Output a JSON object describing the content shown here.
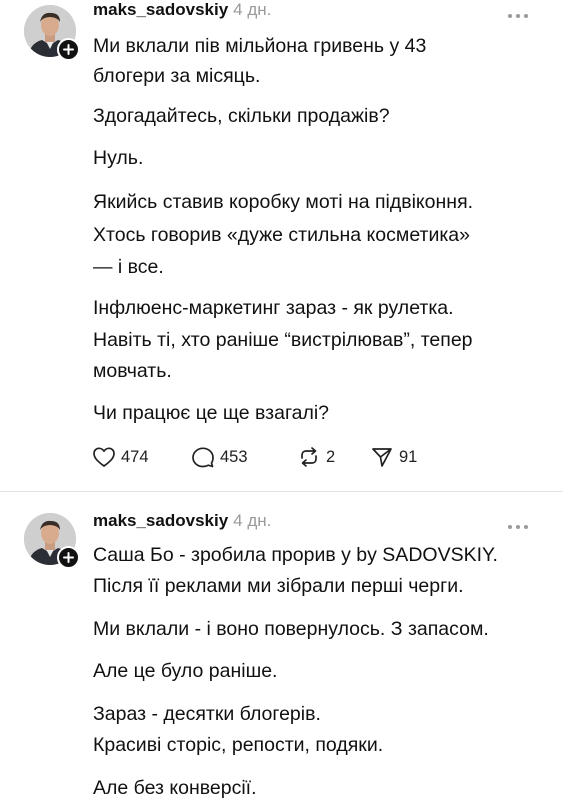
{
  "posts": [
    {
      "username": "maks_sadovskiy",
      "time": "4 дн.",
      "lines": [
        "Ми вклали пів мільйона гривень у 43",
        "блогери за місяць.",
        "Здогадайтесь, скільки продажів?",
        "Нуль.",
        "Якийсь ставив коробку моті на підвіконня.",
        "Хтось говорив «дуже стильна косметика»",
        "— і все.",
        "Інфлюенс-маркетинг зараз - як рулетка.",
        "Навіть ті, хто раніше “вистрілював”, тепер",
        "мовчать.",
        "Чи працює це ще взагалі?"
      ],
      "likes": "474",
      "comments": "453",
      "reposts": "2",
      "shares": "91"
    },
    {
      "username": "maks_sadovskiy",
      "time": "4 дн.",
      "lines": [
        "Саша Бо - зробила прорив у by SADOVSKIY.",
        "Після її реклами ми зібрали перші черги.",
        "Ми вклали - і воно повернулось. З запасом.",
        "Але це було раніше.",
        "Зараз - десятки блогерів.",
        "Красиві сторіс, репости, подяки.",
        "Але без конверсії."
      ]
    }
  ],
  "icons": {
    "avatar": "avatar-photo",
    "follow": "plus-icon",
    "more": "more-dots-icon",
    "like": "heart-icon",
    "comment": "comment-icon",
    "repost": "repost-icon",
    "share": "share-icon"
  }
}
